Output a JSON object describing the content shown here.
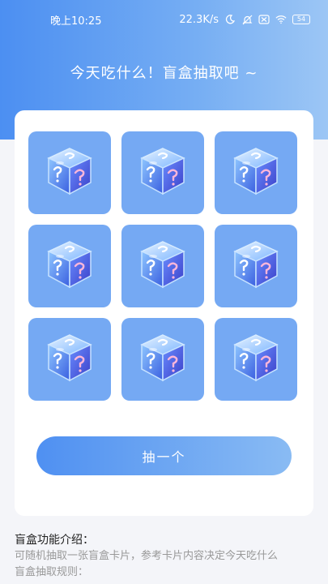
{
  "status_bar": {
    "time": "晚上10:25",
    "net_speed": "22.3K/s",
    "battery": "54"
  },
  "header": {
    "title": "今天吃什么！盲盒抽取吧 ~"
  },
  "grid": {
    "boxes": [
      "mystery-box",
      "mystery-box",
      "mystery-box",
      "mystery-box",
      "mystery-box",
      "mystery-box",
      "mystery-box",
      "mystery-box",
      "mystery-box"
    ]
  },
  "draw_button": {
    "label": "抽一个"
  },
  "intro": {
    "title": "盲盒功能介绍：",
    "line1": "可随机抽取一张盲盒卡片，参考卡片内容决定今天吃什么",
    "line2": "盲盒抽取规则："
  },
  "colors": {
    "header_gradient_start": "#4c8ff2",
    "box_bg": "#75a9f3",
    "button_gradient_start": "#4f90f2",
    "button_gradient_end": "#89bbf3"
  }
}
